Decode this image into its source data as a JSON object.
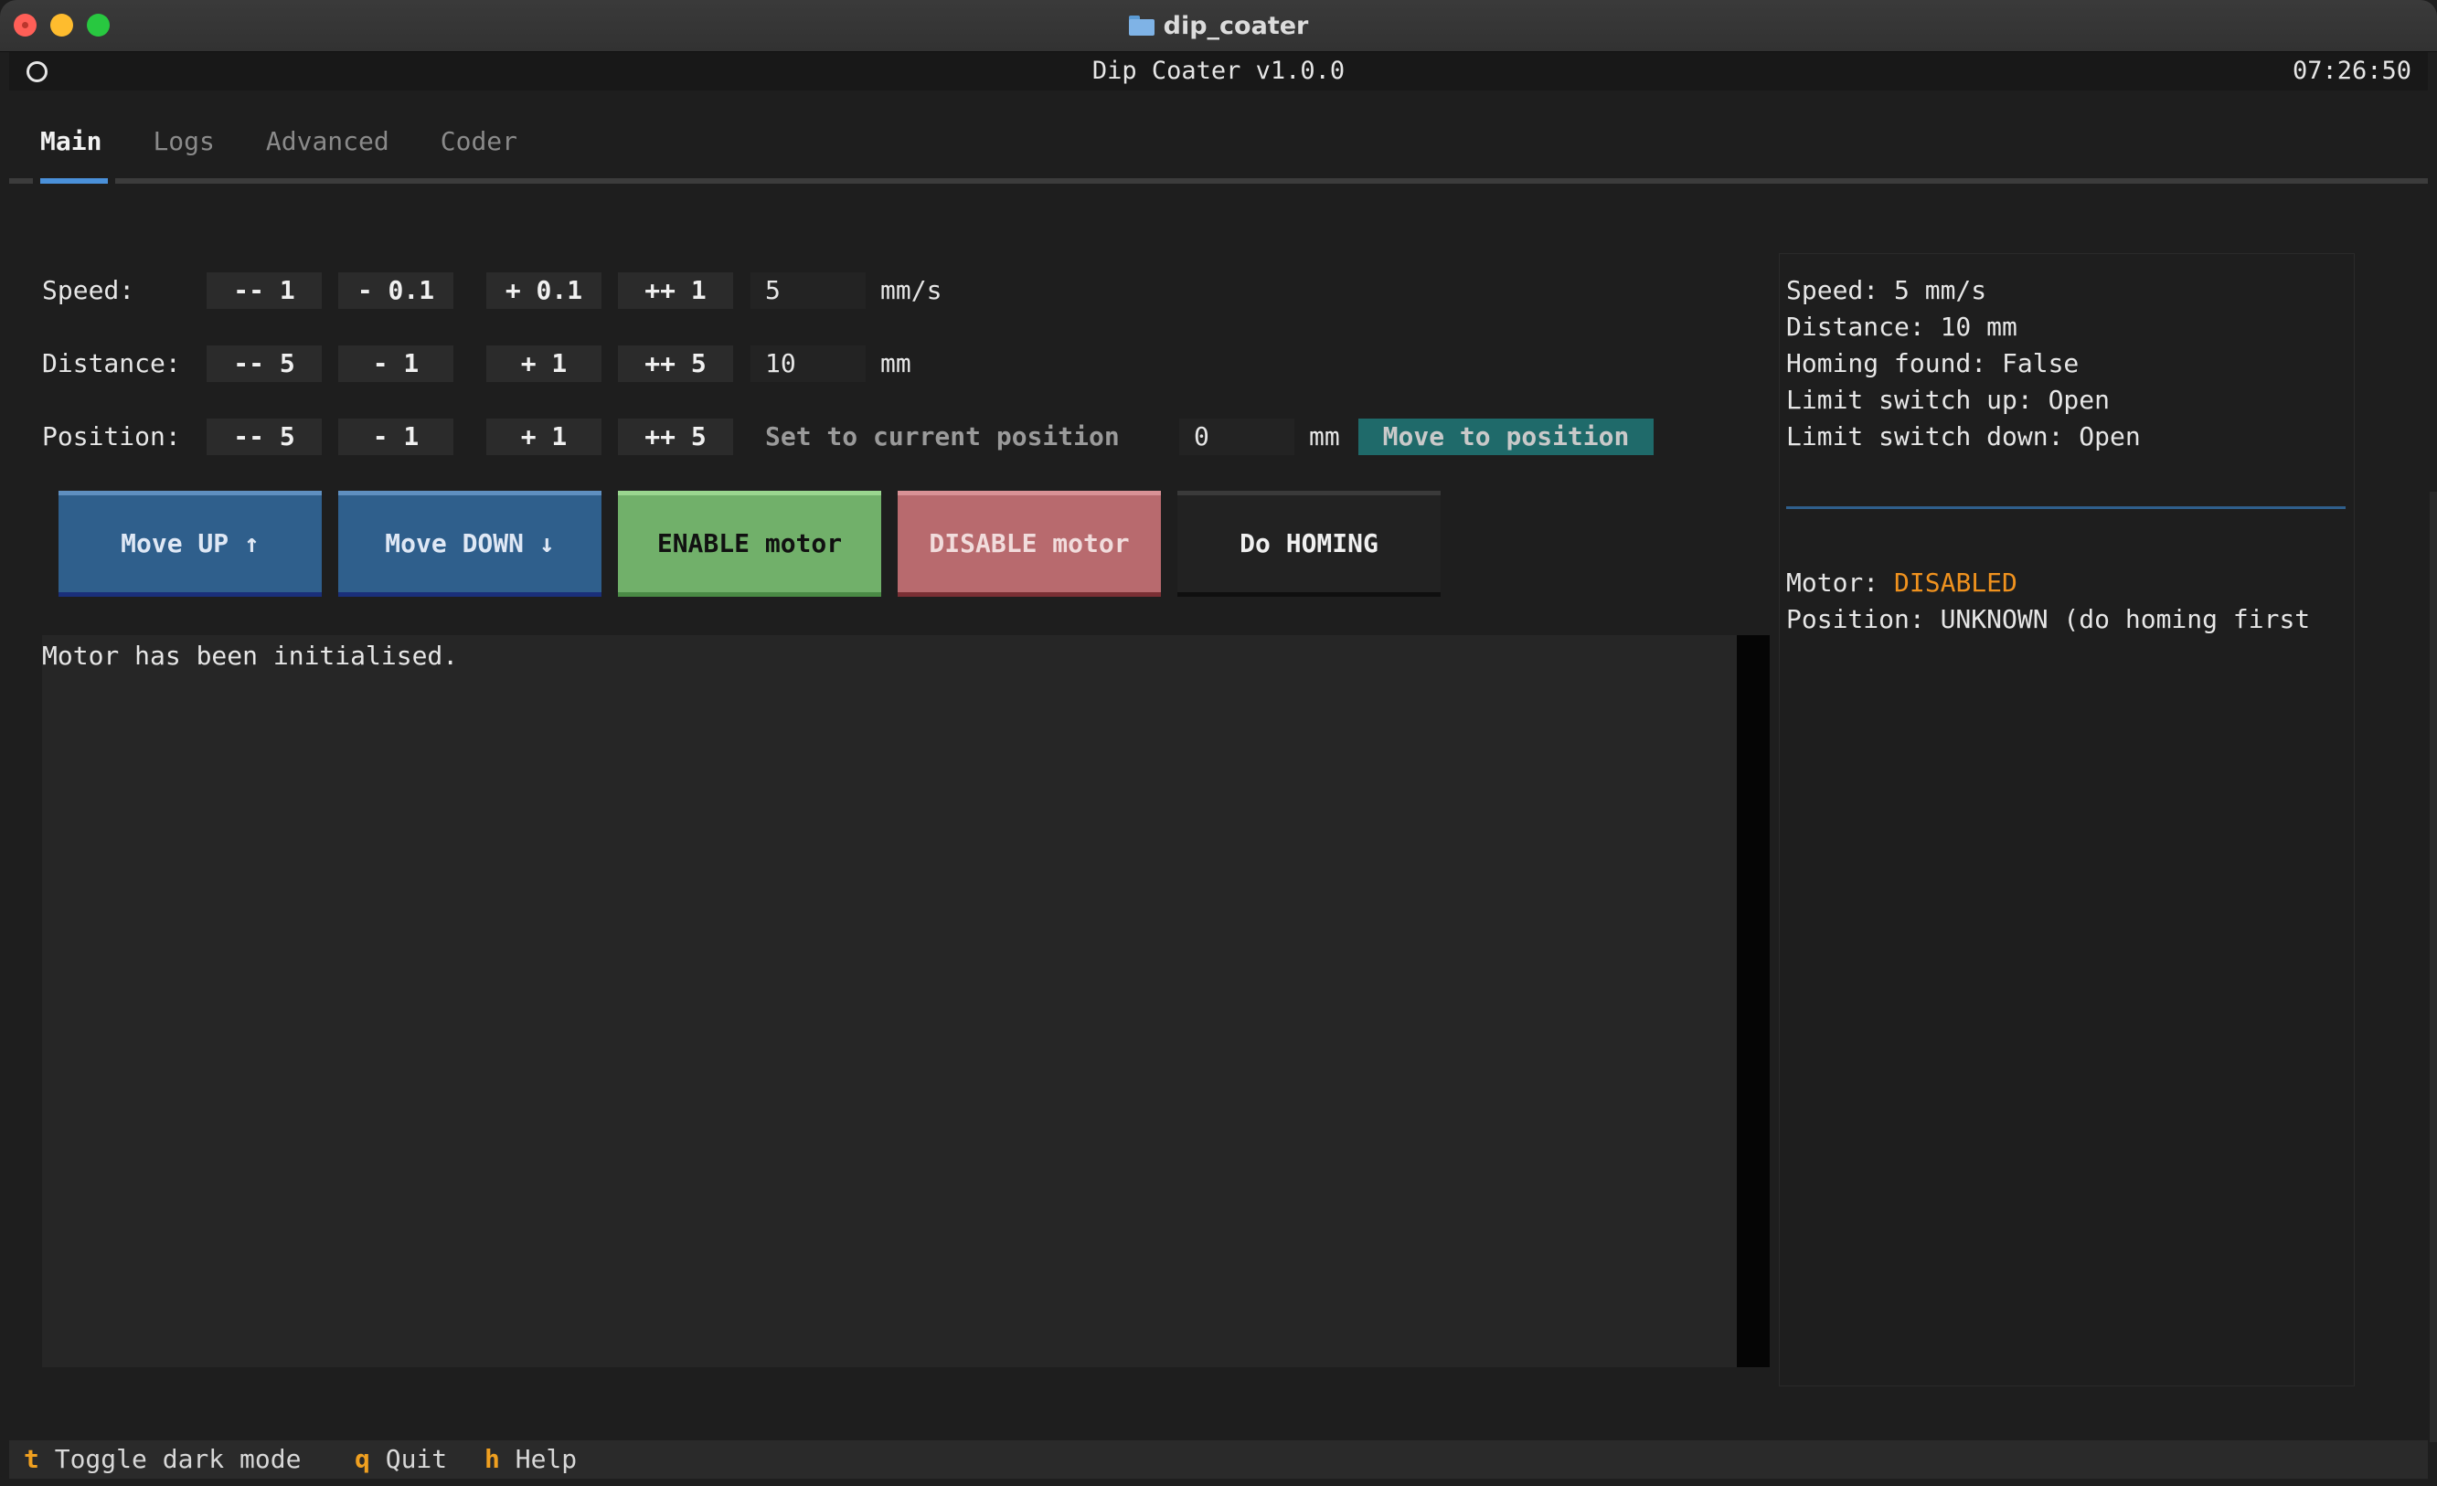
{
  "window": {
    "title": "dip_coater"
  },
  "header": {
    "title": "Dip Coater v1.0.0",
    "clock": "07:26:50"
  },
  "tabs": [
    {
      "label": "Main",
      "active": true
    },
    {
      "label": "Logs",
      "active": false
    },
    {
      "label": "Advanced",
      "active": false
    },
    {
      "label": "Coder",
      "active": false
    }
  ],
  "controls": {
    "speed": {
      "label": "Speed:",
      "buttons": [
        "-- 1",
        "- 0.1",
        "+ 0.1",
        "++ 1"
      ],
      "value": "5",
      "unit": "mm/s"
    },
    "distance": {
      "label": "Distance:",
      "buttons": [
        "-- 5",
        "- 1",
        "+ 1",
        "++ 5"
      ],
      "value": "10",
      "unit": "mm"
    },
    "position": {
      "label": "Position:",
      "buttons": [
        "-- 5",
        "- 1",
        "+ 1",
        "++ 5"
      ],
      "set_current_label": "Set to current position",
      "value": "0",
      "unit": "mm",
      "move_label": "Move to position"
    }
  },
  "actions": {
    "move_up": "Move UP ↑",
    "move_down": "Move DOWN ↓",
    "enable": "ENABLE motor",
    "disable": "DISABLE motor",
    "homing": "Do HOMING"
  },
  "log": {
    "lines": [
      "Motor has been initialised."
    ]
  },
  "status": {
    "speed": "Speed: 5 mm/s",
    "distance": "Distance: 10 mm",
    "homing": "Homing found: False",
    "limit_up": "Limit switch up: Open",
    "limit_down": "Limit switch down: Open",
    "motor_label": "Motor: ",
    "motor_value": "DISABLED",
    "position": "Position: UNKNOWN (do homing first"
  },
  "footer": [
    {
      "key": "t",
      "label": "Toggle dark mode"
    },
    {
      "key": "q",
      "label": "Quit"
    },
    {
      "key": "h",
      "label": "Help"
    }
  ],
  "colors": {
    "accent": "#4a90d9",
    "move_button": "#2f5f8c",
    "enable_button": "#71b06a",
    "disable_button": "#b86a6e",
    "move_to_position": "#1f6a6a",
    "motor_disabled": "#f0921e",
    "footer_key": "#f0a020"
  }
}
